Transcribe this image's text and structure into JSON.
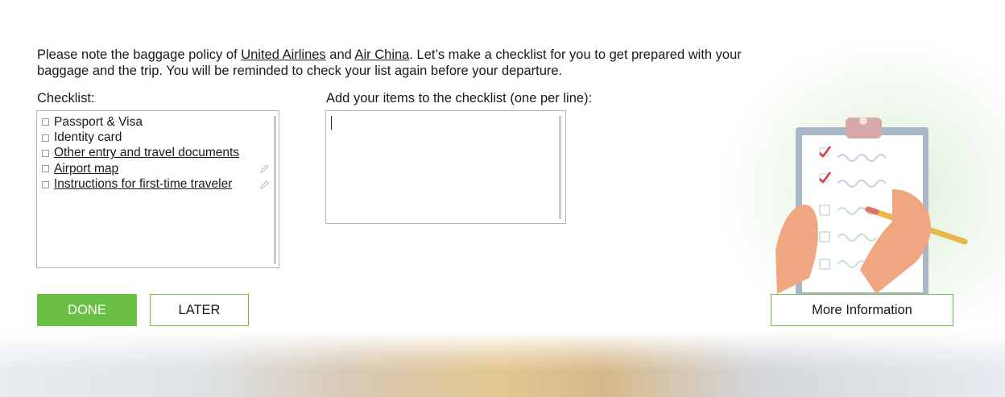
{
  "intro": {
    "part1": "Please note the baggage policy of ",
    "link_united": "United Airlines",
    "part2": " and ",
    "link_airchina": "Air China",
    "part3": ". Let’s make a checklist for you to get prepared with your baggage and the trip. You will be reminded to check your list again before your departure."
  },
  "checklist": {
    "label": "Checklist:",
    "items": [
      {
        "label": "Passport & Visa",
        "link": false,
        "editable": false
      },
      {
        "label": "Identity card",
        "link": false,
        "editable": false
      },
      {
        "label": "Other entry and travel documents",
        "link": true,
        "editable": false
      },
      {
        "label": "Airport map",
        "link": true,
        "editable": true
      },
      {
        "label": "Instructions for first-time traveler",
        "link": true,
        "editable": true
      }
    ]
  },
  "add_items": {
    "label": "Add your items to the checklist (one per line):",
    "value": ""
  },
  "buttons": {
    "done": "DONE",
    "later": "LATER",
    "more_info": "More Information"
  },
  "colors": {
    "accent": "#6abf45"
  },
  "icons": {
    "edit": "pencil-icon",
    "illustration": "clipboard-checklist-illustration"
  }
}
